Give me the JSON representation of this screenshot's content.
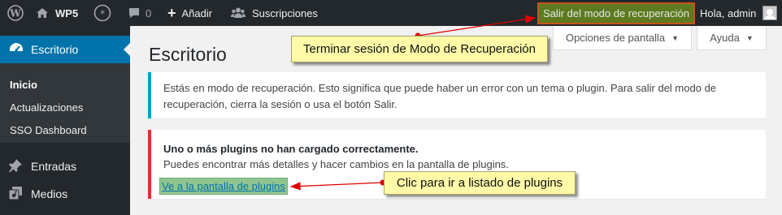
{
  "adminbar": {
    "site_name": "WP5",
    "comments_count": "0",
    "new_label": "Añadir",
    "subscriptions_label": "Suscripciones",
    "recovery_label": "Salir del modo de recuperación",
    "howdy_label": "Hola, admin"
  },
  "sidebar": {
    "active_label": "Escritorio",
    "submenu": [
      "Inicio",
      "Actualizaciones",
      "SSO Dashboard"
    ],
    "items": [
      "Entradas",
      "Medios"
    ]
  },
  "screen_options_label": "Opciones de pantalla",
  "help_label": "Ayuda",
  "page_title": "Escritorio",
  "notice_info_text": "Estás en modo de recuperación. Esto significa que puede haber un error con un tema o plugin. Para salir del modo de recuperación, cierra la sesión o usa el botón Salir.",
  "notice_error": {
    "title": "Uno o más plugins no han cargado correctamente.",
    "body": "Puedes encontrar más detalles y hacer cambios en la pantalla de plugins.",
    "link": "Ve a la pantalla de plugins"
  },
  "callouts": {
    "logout": "Terminar sesión de Modo de Recuperación",
    "plugins": "Clic para ir a listado de plugins"
  },
  "colors": {
    "adminbar_bg": "#23282d",
    "menu_active_bg": "#0073aa",
    "info_border": "#00a0d2",
    "error_border": "#dc3232",
    "callout_bg": "#fffaa8",
    "arrow": "#e00000"
  }
}
